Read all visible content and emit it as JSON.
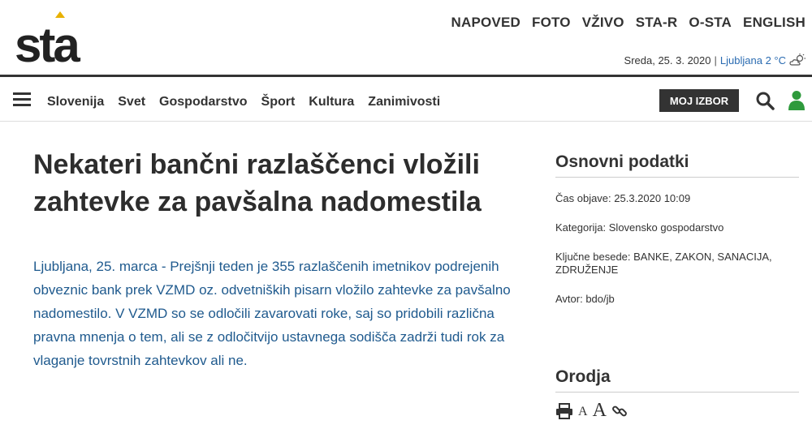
{
  "logo_text": "sta",
  "top_nav": [
    "NAPOVED",
    "FOTO",
    "VŽIVO",
    "STA-R",
    "O-STA",
    "ENGLISH"
  ],
  "date_line": {
    "date": "Sreda, 25. 3. 2020",
    "separator": "|",
    "weather": "Ljubljana 2 °C"
  },
  "main_nav": [
    "Slovenija",
    "Svet",
    "Gospodarstvo",
    "Šport",
    "Kultura",
    "Zanimivosti"
  ],
  "moj_izbor_label": "MOJ IZBOR",
  "article": {
    "headline": "Nekateri bančni razlaščenci vložili zahtevke za pavšalna nadomestila",
    "lead": "Ljubljana, 25. marca - Prejšnji teden je 355 razlaščenih imetnikov podrejenih obveznic bank prek VZMD oz. odvetniških pisarn vložilo zahtevke za pavšalno nadomestilo. V VZMD so se odločili zavarovati roke, saj so pridobili različna pravna mnenja o tem, ali se z odločitvijo ustavnega sodišča zadrži tudi rok za vlaganje tovrstnih zahtevkov ali ne."
  },
  "sidebar": {
    "basic_title": "Osnovni podatki",
    "published": "Čas objave: 25.3.2020 10:09",
    "category": "Kategorija: Slovensko gospodarstvo",
    "keywords": "Ključne besede: BANKE, ZAKON, SANACIJA, ZDRUŽENJE",
    "author": "Avtor: bdo/jb",
    "tools_title": "Orodja",
    "font_small": "A",
    "font_large": "A"
  },
  "colors": {
    "accent_logo": "#e8b100",
    "link_blue": "#1f5a8e",
    "user_green": "#2e9a3c",
    "dark": "#333333"
  }
}
